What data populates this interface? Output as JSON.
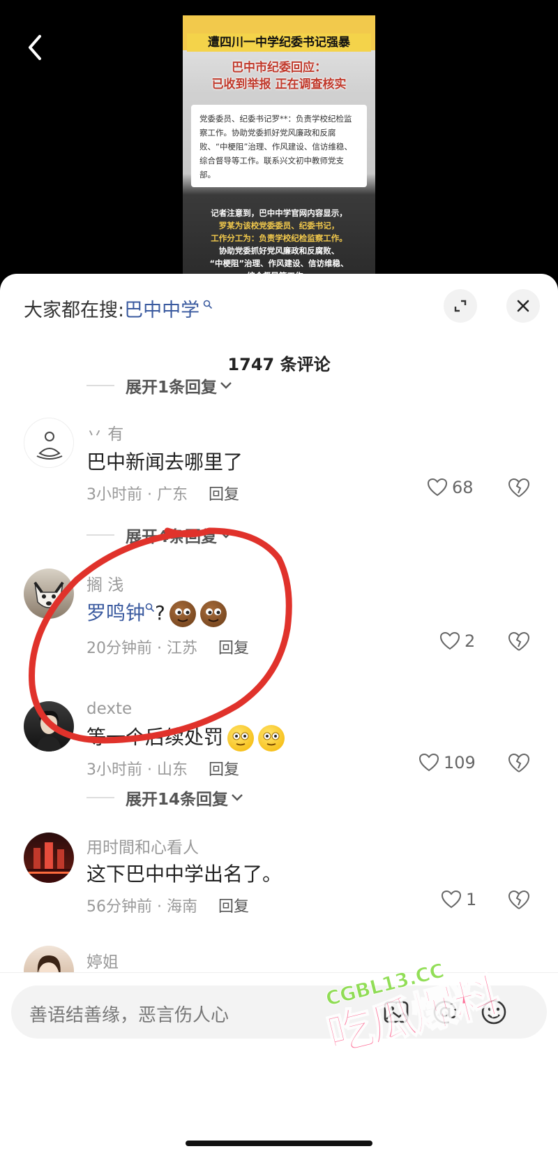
{
  "video": {
    "title_line1": "遭四川一中学纪委书记强暴",
    "title_line2": "巴中市纪委回应：",
    "title_line3": "已收到举报 正在调查核实",
    "card_text": "党委委员、纪委书记罗**：负责学校纪检监察工作。协助党委抓好党风廉政和反腐败、“中梗阻”治理、作风建设、信访维稳、综合督导等工作。联系兴文初中教师党支部。",
    "dark_lines": [
      {
        "text": "记者注意到，巴中中学官网内容显示，",
        "highlight": false
      },
      {
        "text": "罗某为该校党委委员、纪委书记，",
        "highlight": true
      },
      {
        "text": "工作分工为：负责学校纪检监察工作。",
        "highlight": true
      },
      {
        "text": "协助党委抓好党风廉政和反腐败、",
        "highlight": false
      },
      {
        "text": "“中梗阻”治理、作风建设、信访维稳、",
        "highlight": false
      },
      {
        "text": "综合督导等工作。",
        "highlight": false
      }
    ]
  },
  "sheet": {
    "search_prefix": "大家都在搜:",
    "search_term": "巴中中学",
    "comment_count": "1747 条评论"
  },
  "expand_rows": [
    "展开1条回复",
    "展开4条回复",
    "展开14条回复"
  ],
  "comments": [
    {
      "username": "丷 有",
      "text": "巴中新闻去哪里了",
      "meta": "3小时前 · 广东",
      "reply": "回复",
      "likes": "68"
    },
    {
      "username": "搁 浅",
      "text": "罗鸣钟",
      "suffix": "?",
      "meta": "20分钟前 · 江苏",
      "reply": "回复",
      "likes": "2"
    },
    {
      "username": "dexte",
      "text": "等一个后续处罚",
      "meta": "3小时前 · 山东",
      "reply": "回复",
      "likes": "109"
    },
    {
      "username": "用时間和心看人",
      "text": "这下巴中中学出名了。",
      "meta": "56分钟前 · 海南",
      "reply": "回复",
      "likes": "1"
    },
    {
      "username": "婷姐",
      "text": "",
      "meta": "",
      "reply": "",
      "likes": ""
    }
  ],
  "input": {
    "placeholder": "善语结善缘，恶言伤人心"
  },
  "watermark": {
    "site": "CGBL13.CC",
    "brand": "吃瓜爆料"
  },
  "colors": {
    "link": "#3a5a9f",
    "annotation": "#e0322b"
  }
}
